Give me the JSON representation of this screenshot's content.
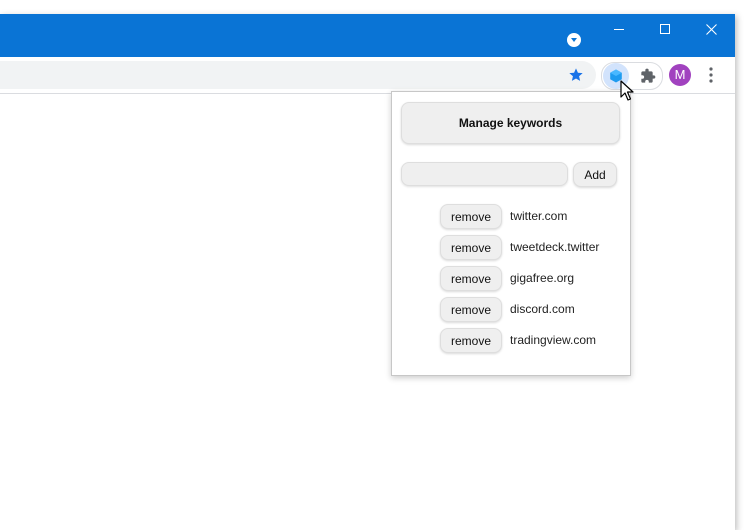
{
  "window": {
    "minimize_icon": "minimize-icon",
    "maximize_icon": "maximize-icon",
    "close_icon": "close-icon"
  },
  "toolbar": {
    "profile_initial": "M",
    "accent_color": "#0a74d5",
    "star_color": "#1a73e8",
    "avatar_color": "#a142bf"
  },
  "popup": {
    "manage_label": "Manage keywords",
    "input_value": "",
    "input_placeholder": "",
    "add_label": "Add",
    "keywords": [
      {
        "remove_label": "remove",
        "keyword": "twitter.com"
      },
      {
        "remove_label": "remove",
        "keyword": "tweetdeck.twitter"
      },
      {
        "remove_label": "remove",
        "keyword": "gigafree.org"
      },
      {
        "remove_label": "remove",
        "keyword": "discord.com"
      },
      {
        "remove_label": "remove",
        "keyword": "tradingview.com"
      }
    ]
  }
}
